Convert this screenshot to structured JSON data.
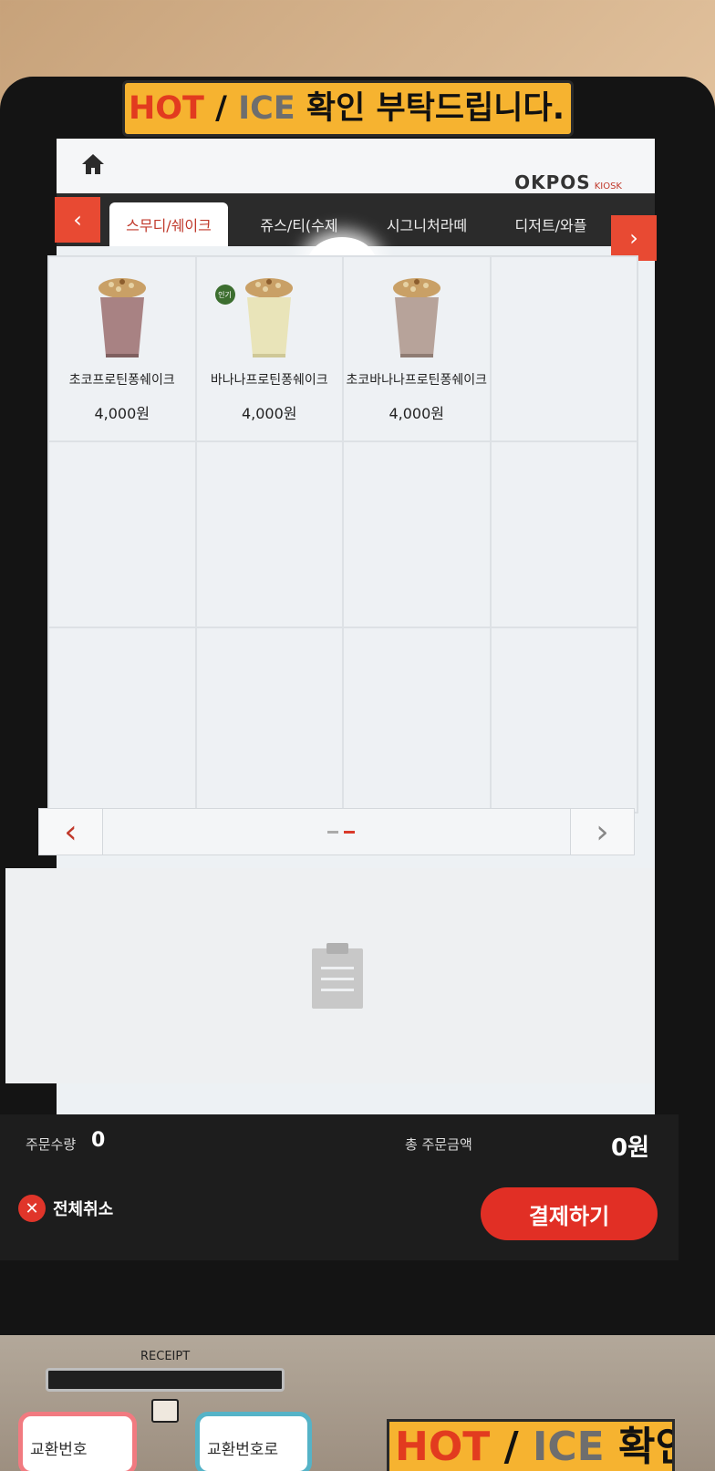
{
  "sticker_top": {
    "hot": "HOT",
    "slash": "/",
    "ice": "ICE",
    "confirm": "확인 부탁드립니다."
  },
  "header": {
    "brand": "OKPOS",
    "brand_sub": "KIOSK"
  },
  "tabs": [
    {
      "label": "스무디/쉐이크",
      "active": true
    },
    {
      "label": "쥬스/티(수제",
      "active": false
    },
    {
      "label": "시그니처라떼",
      "active": false
    },
    {
      "label": "디저트/와플",
      "active": false
    }
  ],
  "products": [
    {
      "name": "초코프로틴퐁쉐이크",
      "price": "4,000원",
      "badge": ""
    },
    {
      "name": "바나나프로틴퐁쉐이크",
      "price": "4,000원",
      "badge": "인기"
    },
    {
      "name": "초코바나나프로틴퐁쉐이크",
      "price": "4,000원",
      "badge": ""
    }
  ],
  "pager": {
    "page_count": 2,
    "current_page": 2
  },
  "summary": {
    "qty_label": "주문수량",
    "qty_value": "0",
    "total_label": "총 주문금액",
    "total_value": "0원"
  },
  "actions": {
    "cancel_label": "전체취소",
    "pay_label": "결제하기"
  },
  "base": {
    "receipt_label": "RECEIPT",
    "note_1": "교환번호",
    "note_2": "교환번호로"
  },
  "sticker_bottom": {
    "hot": "HOT",
    "slash": "/",
    "ice": "ICE",
    "confirm": "확인"
  },
  "colors": {
    "accent": "#e12f25",
    "tab_bar": "#2b2b2b",
    "sticker": "#f6b330"
  }
}
